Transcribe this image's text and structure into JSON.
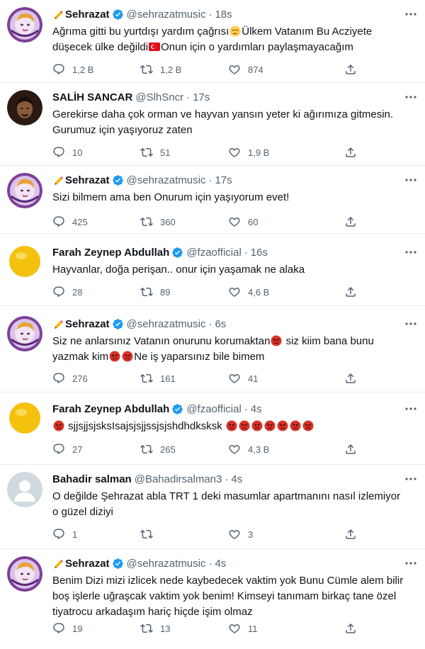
{
  "tweets": [
    {
      "name": "Sehrazat",
      "verified": true,
      "handle": "@sehrazatmusic",
      "time": "18s",
      "text_parts": [
        "Ağrıma gitti bu yurtdışı yardım çağrısı",
        "Ülkem Vatanım Bu Acziyete düşecek ülke değildi",
        "Onun için o yardımları paylaşmayacağım"
      ],
      "replies": "1,2 B",
      "retweets": "1,2 B",
      "likes": "874"
    },
    {
      "name": "SALİH SANCAR",
      "verified": false,
      "handle": "@SlhSncr",
      "time": "17s",
      "text": "Gerekirse daha çok orman ve hayvan yansın yeter ki ağırımıza gitmesin. Gurumuz için yaşıyoruz zaten",
      "replies": "10",
      "retweets": "51",
      "likes": "1,9 B"
    },
    {
      "name": "Sehrazat",
      "verified": true,
      "handle": "@sehrazatmusic",
      "time": "17s",
      "text": "Sizi bilmem ama ben Onurum için yaşıyorum evet!",
      "replies": "425",
      "retweets": "360",
      "likes": "60"
    },
    {
      "name": "Farah Zeynep Abdullah",
      "verified": true,
      "handle": "@fzaofficial",
      "time": "16s",
      "text": "Hayvanlar, doğa perişan.. onur için yaşamak ne alaka",
      "replies": "28",
      "retweets": "89",
      "likes": "4,6 B"
    },
    {
      "name": "Sehrazat",
      "verified": true,
      "handle": "@sehrazatmusic",
      "time": "6s",
      "text_parts": [
        "Siz ne anlarsınız Vatanın onurunu korumaktan",
        " siz kiim bana bunu yazmak kim",
        "Ne iş yaparsınız bile bimem"
      ],
      "replies": "276",
      "retweets": "161",
      "likes": "41"
    },
    {
      "name": "Farah Zeynep Abdullah",
      "verified": true,
      "handle": "@fzaofficial",
      "time": "4s",
      "text": " sjjsjjsjsksIsajsjsjjssjsjshdhdksksk ",
      "replies": "27",
      "retweets": "265",
      "likes": "4,3 B"
    },
    {
      "name": "Bahadir salman",
      "verified": false,
      "handle": "@Bahadirsalman3",
      "time": "4s",
      "text": "O değilde Şehrazat abla TRT 1 deki masumlar apartmanını nasıl izlemiyor o güzel diziyi",
      "replies": "1",
      "retweets": "",
      "likes": "3"
    },
    {
      "name": "Sehrazat",
      "verified": true,
      "handle": "@sehrazatmusic",
      "time": "4s",
      "text": "Benim Dizi mizi izlicek nede kaybedecek vaktim yok Bunu Cümle alem bilir boş işlerle uğraşcak vaktim yok benim! Kimseyi tanımam birkaç tane özel tiyatrocu arkadaşım hariç hiçde işim olmaz",
      "replies": "19",
      "retweets": "13",
      "likes": "11"
    }
  ],
  "separator": "·",
  "colors": {
    "text": "#0f1419",
    "secondary": "#536471",
    "verified": "#1d9bf0",
    "border": "#e6ecf0"
  },
  "icons": {
    "reply": "reply-icon",
    "retweet": "retweet-icon",
    "like": "like-icon",
    "share": "share-icon",
    "more": "more-icon",
    "verified": "verified-badge-icon"
  }
}
